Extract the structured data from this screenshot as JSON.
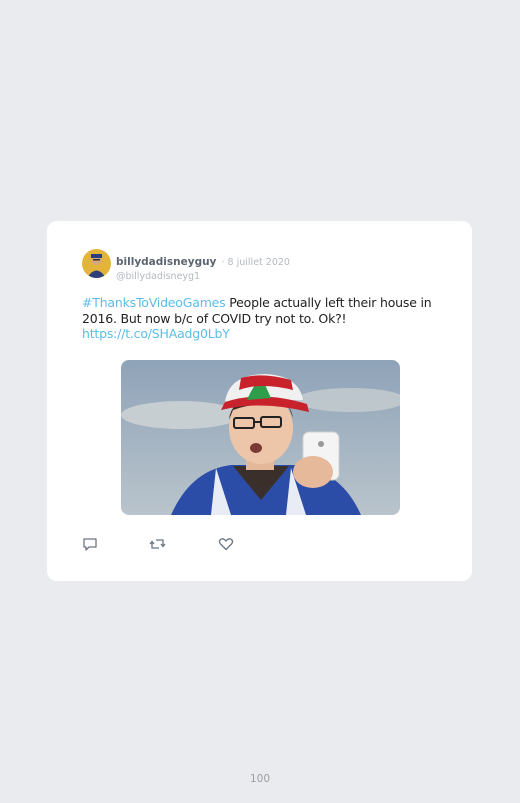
{
  "tweet": {
    "author_name": "billydadisneyguy",
    "date": "8 juillet 2020",
    "handle": "@billydadisneyg1",
    "hashtag": "#ThanksToVideoGames",
    "text_body": " People actually left their house in 2016. But now b/c of COVID try not to. Ok?! ",
    "link": "https://t.co/SHAadg0LbY"
  },
  "actions": [
    "reply-icon",
    "retweet-icon",
    "like-icon"
  ],
  "page_number": "100",
  "colors": {
    "background": "#e9ebee",
    "card": "#ffffff",
    "link": "#5bbde8",
    "muted": "#b3b9c0"
  }
}
